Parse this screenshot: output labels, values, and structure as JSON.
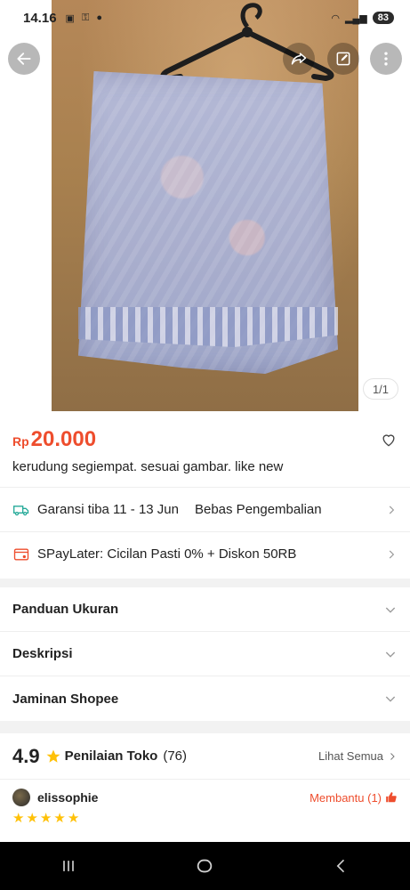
{
  "status_bar": {
    "time": "14.16",
    "battery": "83"
  },
  "gallery": {
    "counter": "1/1"
  },
  "product": {
    "currency": "Rp",
    "price": "20.000",
    "title": "kerudung segiempat. sesuai gambar. like new"
  },
  "shipping": {
    "guarantee": "Garansi tiba 11 - 13 Jun",
    "returns": "Bebas Pengembalian"
  },
  "paylater": {
    "text": "SPayLater: Cicilan Pasti 0% + Diskon 50RB"
  },
  "sections": [
    {
      "label": "Panduan Ukuran"
    },
    {
      "label": "Deskripsi"
    },
    {
      "label": "Jaminan Shopee"
    }
  ],
  "shop_rating": {
    "score": "4.9",
    "label": "Penilaian Toko",
    "count": "(76)",
    "see_all": "Lihat Semua"
  },
  "review": {
    "username": "elissophie",
    "helpful": "Membantu (1)",
    "stars": 5
  },
  "colors": {
    "accent": "#ee4d2d",
    "star": "#ffc107",
    "shipping_icon": "#26aa99"
  },
  "icons": [
    "back-arrow-icon",
    "share-icon",
    "edit-icon",
    "more-vertical-icon",
    "heart-icon",
    "truck-icon",
    "paylater-icon",
    "chevron-right-icon",
    "chevron-down-icon",
    "star-icon",
    "thumbs-up-icon"
  ]
}
